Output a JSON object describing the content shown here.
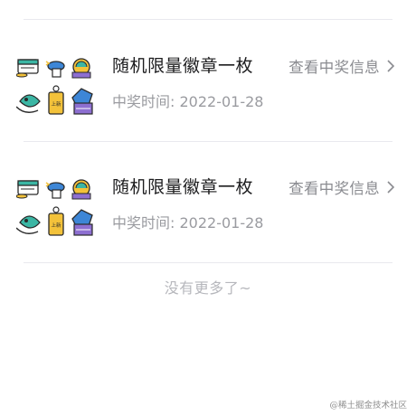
{
  "prizes": [
    {
      "title": "随机限量徽章一枚",
      "date_label": "中奖时间: 2022-01-28",
      "view_label": "查看中奖信息",
      "thumb_text": "上新"
    },
    {
      "title": "随机限量徽章一枚",
      "date_label": "中奖时间: 2022-01-28",
      "view_label": "查看中奖信息",
      "thumb_text": "上新"
    }
  ],
  "footer": {
    "no_more": "没有更多了~"
  },
  "watermark": "@稀土掘金技术社区",
  "icons": {
    "row_link": "chevron-right-icon",
    "thumbnail": "badge-collection-icon"
  },
  "colors": {
    "title": "#1d1d1f",
    "secondary": "#9a9ba0",
    "divider": "#e9e9ee",
    "badge_teal": "#3bb6a4",
    "badge_blue": "#3d86d6",
    "badge_yellow": "#f3c23a",
    "badge_purple": "#8d6fd1"
  }
}
